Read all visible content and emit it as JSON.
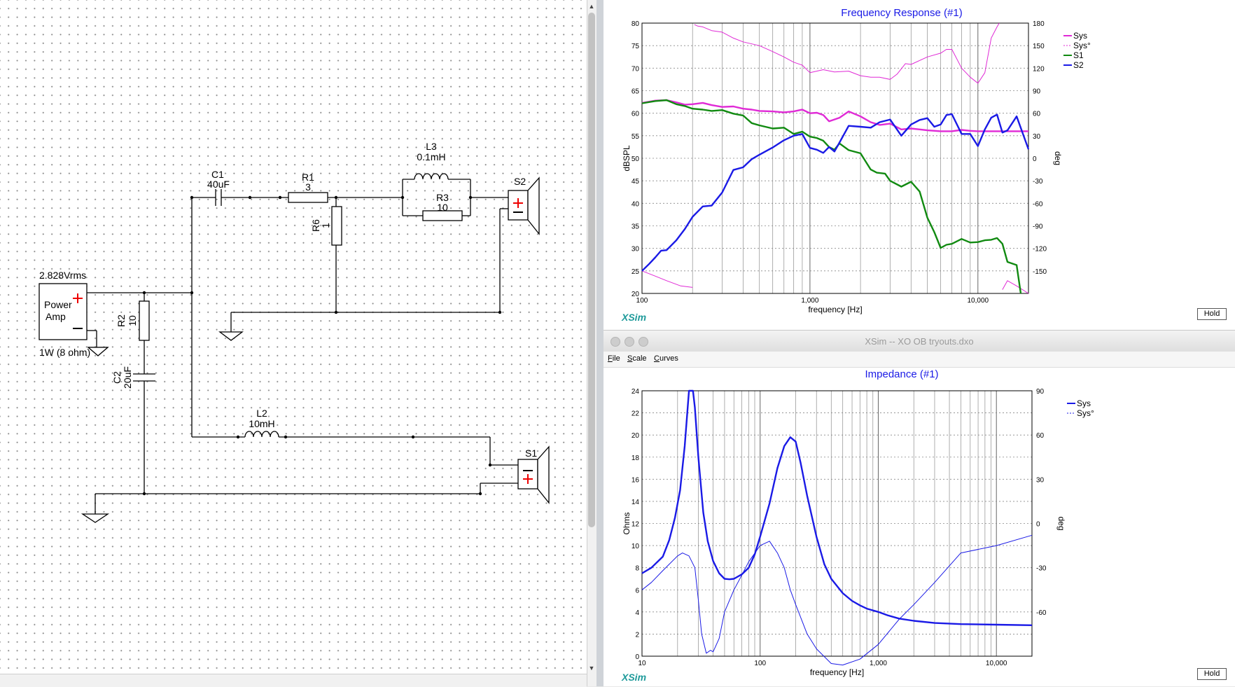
{
  "schematic": {
    "amp": {
      "voltage": "2.828Vrms",
      "name_line1": "Power",
      "name_line2": "Amp",
      "power": "1W (8 ohm)"
    },
    "components": {
      "c1": {
        "name": "C1",
        "value": "40uF"
      },
      "r1": {
        "name": "R1",
        "value": "3"
      },
      "l3": {
        "name": "L3",
        "value": "0.1mH"
      },
      "r3": {
        "name": "R3",
        "value": "10"
      },
      "r6": {
        "name": "R6",
        "value": "1"
      },
      "r2": {
        "name": "R2",
        "value": "10"
      },
      "c2": {
        "name": "C2",
        "value": "20uF"
      },
      "l2": {
        "name": "L2",
        "value": "10mH"
      },
      "s2": {
        "name": "S2"
      },
      "s1": {
        "name": "S1"
      }
    }
  },
  "freq_window": {
    "plot_title": "Frequency Response (#1)",
    "xsim_label": "XSim",
    "hold_label": "Hold"
  },
  "imp_window": {
    "window_title": "XSim -- XO OB tryouts.dxo",
    "menus": [
      "File",
      "Scale",
      "Curves"
    ],
    "plot_title": "Impedance (#1)",
    "xsim_label": "XSim",
    "hold_label": "Hold"
  },
  "chart_data": [
    {
      "type": "line",
      "title": "Frequency Response (#1)",
      "xlabel": "frequency [Hz]",
      "ylabel": "dBSPL",
      "y2label": "deg",
      "xscale": "log",
      "xlim": [
        100,
        20000
      ],
      "ylim": [
        20,
        80
      ],
      "y2lim": [
        -180,
        180
      ],
      "xticks": [
        "100",
        "1,000",
        "10,000"
      ],
      "yticks": [
        "80",
        "75",
        "70",
        "65",
        "60",
        "55",
        "50",
        "45",
        "40",
        "35",
        "30",
        "25",
        "20"
      ],
      "y2ticks": [
        "180",
        "150",
        "120",
        "90",
        "60",
        "30",
        "0",
        "-30",
        "-60",
        "-90",
        "-120",
        "-150"
      ],
      "grid": true,
      "legend_position": "right",
      "colors": {
        "Sys": "#e02ad6",
        "Sys°": "#e02ad6",
        "S1": "#118a11",
        "S2": "#1a1ae6"
      },
      "series": [
        {
          "name": "Sys",
          "style": "solid",
          "axis": "left",
          "x": [
            100,
            120,
            140,
            160,
            180,
            200,
            230,
            260,
            300,
            350,
            400,
            450,
            500,
            600,
            700,
            800,
            900,
            1000,
            1100,
            1200,
            1300,
            1500,
            1700,
            2000,
            2300,
            2600,
            3000,
            3500,
            4000,
            4500,
            5000,
            6000,
            7000,
            8000,
            9000,
            10000,
            12000,
            14000,
            17000,
            20000
          ],
          "y": [
            62.3,
            62.8,
            62.9,
            62.4,
            61.9,
            62.0,
            62.3,
            61.8,
            61.4,
            61.5,
            61.0,
            60.8,
            60.5,
            60.4,
            60.2,
            60.4,
            60.8,
            60.0,
            60.1,
            59.6,
            58.2,
            59.0,
            60.4,
            59.3,
            58.0,
            57.4,
            57.7,
            56.4,
            56.6,
            56.4,
            56.2,
            56.0,
            56.0,
            56.3,
            56.1,
            56.0,
            56.0,
            56.0,
            56.0,
            56.0
          ]
        },
        {
          "name": "Sys°",
          "style": "dashed",
          "axis": "right",
          "x": [
            100,
            120,
            140,
            170,
            200,
            205,
            215,
            230,
            260,
            300,
            350,
            400,
            500,
            600,
            700,
            800,
            900,
            1000,
            1200,
            1400,
            1700,
            2000,
            2300,
            2600,
            3000,
            3300,
            3700,
            4000,
            5000,
            6000,
            6500,
            7000,
            8000,
            9000,
            10000,
            11000,
            12000,
            13000,
            13400,
            14000,
            15000,
            17000,
            20000
          ],
          "y": [
            -150,
            -157,
            -163,
            -170,
            -172,
            178,
            176,
            175,
            170,
            168,
            160,
            155,
            150,
            142,
            135,
            128,
            124,
            114,
            118,
            115,
            116,
            110,
            108,
            108,
            105,
            112,
            126,
            125,
            135,
            140,
            145,
            145,
            120,
            108,
            100,
            114,
            160,
            175,
            180,
            -175,
            -163,
            -170,
            -180
          ]
        },
        {
          "name": "S1",
          "style": "solid",
          "axis": "left",
          "x": [
            100,
            120,
            140,
            160,
            180,
            200,
            230,
            260,
            300,
            350,
            400,
            450,
            500,
            600,
            700,
            800,
            900,
            1000,
            1100,
            1200,
            1300,
            1400,
            1500,
            1700,
            2000,
            2300,
            2500,
            2800,
            3000,
            3500,
            4000,
            4500,
            5000,
            5500,
            6000,
            6500,
            7000,
            8000,
            9000,
            10000,
            11000,
            12000,
            13000,
            14000,
            15000,
            17000,
            18000
          ],
          "y": [
            62.2,
            62.7,
            62.9,
            62.0,
            61.6,
            61.0,
            60.8,
            60.5,
            60.7,
            59.9,
            59.5,
            57.8,
            57.3,
            56.6,
            56.8,
            55.4,
            55.9,
            54.8,
            54.5,
            53.9,
            52.5,
            51.9,
            53.3,
            51.8,
            51.1,
            47.5,
            46.8,
            46.6,
            45.0,
            43.7,
            44.8,
            42.6,
            36.8,
            33.6,
            30.1,
            30.8,
            31.0,
            32.1,
            31.3,
            31.4,
            31.8,
            31.9,
            32.3,
            31.0,
            27.0,
            26.3,
            20.0
          ]
        },
        {
          "name": "S2",
          "style": "solid",
          "axis": "left",
          "x": [
            100,
            110,
            120,
            130,
            140,
            160,
            180,
            200,
            230,
            260,
            300,
            350,
            400,
            450,
            500,
            600,
            700,
            800,
            900,
            1000,
            1100,
            1200,
            1300,
            1400,
            1500,
            1700,
            2000,
            2300,
            2600,
            3000,
            3500,
            4000,
            4500,
            5000,
            5500,
            6000,
            6500,
            7000,
            8000,
            9000,
            10000,
            11000,
            12000,
            13000,
            14000,
            15000,
            17000,
            20000
          ],
          "y": [
            25.0,
            26.5,
            28.0,
            29.5,
            29.6,
            31.8,
            34.3,
            37.0,
            39.3,
            39.5,
            42.4,
            47.4,
            48.0,
            49.8,
            50.8,
            52.4,
            54.0,
            55.0,
            55.4,
            52.3,
            51.9,
            51.2,
            52.5,
            51.5,
            53.5,
            57.2,
            57.0,
            56.8,
            58.0,
            58.6,
            55.0,
            57.5,
            58.5,
            58.9,
            57.0,
            57.5,
            59.6,
            59.8,
            55.4,
            55.4,
            52.7,
            56.4,
            59.0,
            59.7,
            55.7,
            56.2,
            59.3,
            52.0
          ]
        }
      ]
    },
    {
      "type": "line",
      "title": "Impedance (#1)",
      "xlabel": "frequency [Hz]",
      "ylabel": "Ohms",
      "y2label": "deg",
      "xscale": "log",
      "xlim": [
        10,
        20000
      ],
      "ylim": [
        0,
        24
      ],
      "y2lim": [
        -90,
        90
      ],
      "xticks": [
        "10",
        "100",
        "1,000",
        "10,000"
      ],
      "yticks": [
        "24",
        "22",
        "20",
        "18",
        "16",
        "14",
        "12",
        "10",
        "8",
        "6",
        "4",
        "2",
        "0"
      ],
      "y2ticks": [
        "90",
        "60",
        "30",
        "0",
        "-30",
        "-60"
      ],
      "grid": true,
      "legend_position": "right",
      "colors": {
        "Sys": "#1a1ae6",
        "Sys°": "#1a1ae6"
      },
      "series": [
        {
          "name": "Sys",
          "style": "solid",
          "axis": "left",
          "x": [
            10,
            12,
            15,
            17,
            19,
            21,
            23,
            25,
            27,
            28,
            30,
            33,
            36,
            40,
            45,
            50,
            55,
            60,
            70,
            80,
            90,
            100,
            120,
            140,
            160,
            180,
            200,
            220,
            250,
            300,
            350,
            400,
            500,
            600,
            700,
            800,
            1000,
            1200,
            1500,
            2000,
            3000,
            5000,
            10000,
            20000
          ],
          "y": [
            7.5,
            8.0,
            9.0,
            10.5,
            12.5,
            15.0,
            19.0,
            24.0,
            24.0,
            22.5,
            18.0,
            13.0,
            10.4,
            8.6,
            7.5,
            7.0,
            6.95,
            7.0,
            7.4,
            8.0,
            9.2,
            10.8,
            13.8,
            17.0,
            19.0,
            19.8,
            19.4,
            17.5,
            14.5,
            10.8,
            8.3,
            7.0,
            5.7,
            5.0,
            4.6,
            4.3,
            4.0,
            3.7,
            3.4,
            3.2,
            3.0,
            2.9,
            2.85,
            2.8
          ]
        },
        {
          "name": "Sys°",
          "style": "dashed",
          "axis": "right",
          "x": [
            10,
            12,
            15,
            20,
            22,
            25,
            28,
            30,
            32,
            35,
            38,
            40,
            45,
            50,
            60,
            70,
            80,
            100,
            120,
            140,
            160,
            180,
            200,
            250,
            300,
            400,
            500,
            700,
            1000,
            1500,
            2000,
            3000,
            5000,
            10000,
            20000
          ],
          "y": [
            -45,
            -40,
            -32,
            -22,
            -20,
            -22,
            -30,
            -52,
            -75,
            -88,
            -86,
            -87,
            -78,
            -60,
            -45,
            -35,
            -26,
            -15,
            -12,
            -20,
            -30,
            -45,
            -55,
            -75,
            -85,
            -95,
            -96,
            -92,
            -82,
            -65,
            -55,
            -40,
            -20,
            -15,
            -8
          ]
        }
      ]
    }
  ]
}
